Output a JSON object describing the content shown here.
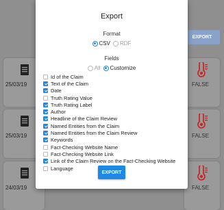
{
  "background": {
    "export_button": "EXPORT",
    "cards": [
      {
        "date": "25/03/19",
        "verdict": "FALSE"
      },
      {
        "date": "25/03/19",
        "verdict": "FALSE"
      },
      {
        "date": "24/03/19",
        "verdict": "FALSE"
      }
    ]
  },
  "modal": {
    "title": "Export",
    "format_label": "Format",
    "format_options": [
      {
        "label": "CSV",
        "selected": true
      },
      {
        "label": "RDF",
        "selected": false
      }
    ],
    "fields_label": "Fields",
    "fields_mode_options": [
      {
        "label": "All",
        "selected": false
      },
      {
        "label": "Customize",
        "selected": true
      }
    ],
    "fields": [
      {
        "label": "Id of the Claim",
        "checked": false
      },
      {
        "label": "Text of the Claim",
        "checked": true
      },
      {
        "label": "Date",
        "checked": true
      },
      {
        "label": "Truth Rating Value",
        "checked": false
      },
      {
        "label": "Truth Rating Label",
        "checked": true
      },
      {
        "label": "Author",
        "checked": true
      },
      {
        "label": "Headline of the Claim Review",
        "checked": true
      },
      {
        "label": "Named Entities from the Claim",
        "checked": true
      },
      {
        "label": "Named Entities from the Claim Review",
        "checked": true
      },
      {
        "label": "Keywords",
        "checked": true
      },
      {
        "label": "Fact-Checking Website Name",
        "checked": false
      },
      {
        "label": "Fact-Checking Website Link",
        "checked": false
      },
      {
        "label": "Link of the Claim Review on the Fact-Checking Website",
        "checked": true
      },
      {
        "label": "Language",
        "checked": false
      }
    ],
    "export_button": "EXPORT"
  },
  "colors": {
    "accent": "#1e88e5",
    "thermometer": "#c62828",
    "overlay": "#8f8f8f"
  }
}
